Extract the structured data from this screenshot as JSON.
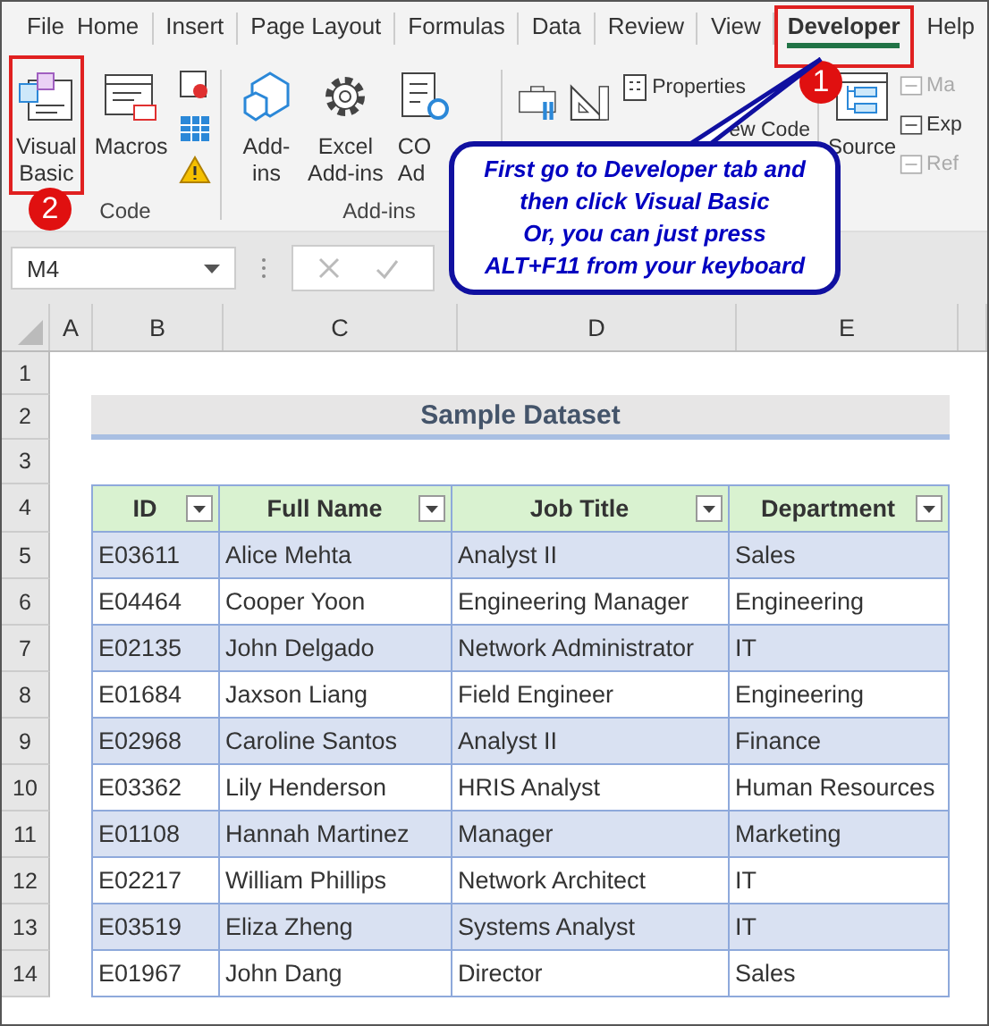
{
  "menu_tabs": [
    {
      "label": "File",
      "selected": false
    },
    {
      "label": "Home",
      "selected": false
    },
    {
      "label": "Insert",
      "selected": false
    },
    {
      "label": "Page Layout",
      "selected": false
    },
    {
      "label": "Formulas",
      "selected": false
    },
    {
      "label": "Data",
      "selected": false
    },
    {
      "label": "Review",
      "selected": false
    },
    {
      "label": "View",
      "selected": false
    },
    {
      "label": "Developer",
      "selected": true
    },
    {
      "label": "Help",
      "selected": false
    }
  ],
  "ribbon": {
    "code_group": {
      "label": "Code",
      "visual_basic": [
        "Visual",
        "Basic"
      ],
      "macros": [
        "Macros"
      ]
    },
    "addins_group": {
      "label": "Add-ins",
      "add_ins": [
        "Add-",
        "ins"
      ],
      "excel_add_ins": [
        "Excel",
        "Add-ins"
      ],
      "com_add_ins": [
        "CO",
        "Ad"
      ]
    },
    "controls_group": {
      "properties": "Properties",
      "view_code": "ew Code"
    },
    "xml_group": {
      "source": "Source",
      "small_items": [
        {
          "label": "Ma",
          "disabled": true
        },
        {
          "label": "Exp",
          "disabled": false
        },
        {
          "label": "Ref",
          "disabled": true
        }
      ]
    }
  },
  "step_badges": [
    "1",
    "2"
  ],
  "callout": "First go to Developer tab and\nthen click Visual Basic\nOr, you can just press\nALT+F11 from your keyboard",
  "name_box": "M4",
  "sheet": {
    "columns": [
      "A",
      "B",
      "C",
      "D",
      "E"
    ],
    "row_numbers": [
      "1",
      "2",
      "3",
      "4",
      "5",
      "6",
      "7",
      "8",
      "9",
      "10",
      "11",
      "12",
      "13",
      "14"
    ],
    "title": "Sample Dataset",
    "table": {
      "columns": [
        "ID",
        "Full Name",
        "Job Title",
        "Department"
      ],
      "rows": [
        [
          "E03611",
          "Alice Mehta",
          "Analyst II",
          "Sales"
        ],
        [
          "E04464",
          "Cooper Yoon",
          "Engineering Manager",
          "Engineering"
        ],
        [
          "E02135",
          "John Delgado",
          "Network Administrator",
          "IT"
        ],
        [
          "E01684",
          "Jaxson Liang",
          "Field Engineer",
          "Engineering"
        ],
        [
          "E02968",
          "Caroline Santos",
          "Analyst II",
          "Finance"
        ],
        [
          "E03362",
          "Lily Henderson",
          "HRIS Analyst",
          "Human Resources"
        ],
        [
          "E01108",
          "Hannah Martinez",
          "Manager",
          "Marketing"
        ],
        [
          "E02217",
          "William Phillips",
          "Network Architect",
          "IT"
        ],
        [
          "E03519",
          "Eliza Zheng",
          "Systems Analyst",
          "IT"
        ],
        [
          "E01967",
          "John Dang",
          "Director",
          "Sales"
        ]
      ]
    }
  }
}
